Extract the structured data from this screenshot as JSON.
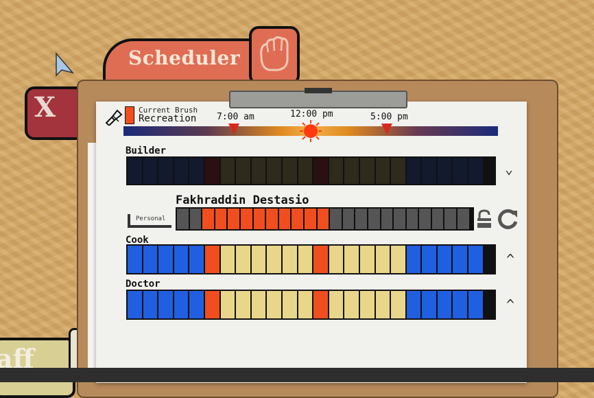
{
  "header": {
    "tab_title": "Scheduler",
    "close_label": "X",
    "staff_tab_label": "aff"
  },
  "brush": {
    "caption": "Current Brush",
    "name": "Recreation",
    "color": "#f04e1e"
  },
  "timeline": {
    "labels": [
      "7:00 am",
      "12:00 pm",
      "5:00 pm"
    ]
  },
  "colors": {
    "dark": "#131a2e",
    "brown": "#2e2a1c",
    "maroon": "#2a1010",
    "blue": "#1f5fe0",
    "yellow": "#e8d78a",
    "orange": "#f04e1e",
    "gray": "#555555"
  },
  "rows": [
    {
      "label": "Builder",
      "chevron": "⌄",
      "pattern": [
        "dark",
        "dark",
        "dark",
        "dark",
        "dark",
        "maroon",
        "brown",
        "brown",
        "brown",
        "brown",
        "brown",
        "brown",
        "maroon",
        "brown",
        "brown",
        "brown",
        "brown",
        "brown",
        "dark",
        "dark",
        "dark",
        "dark",
        "dark"
      ]
    },
    {
      "label": "Cook",
      "chevron": "^",
      "pattern": [
        "blue",
        "blue",
        "blue",
        "blue",
        "blue",
        "orange",
        "yellow",
        "yellow",
        "yellow",
        "yellow",
        "yellow",
        "yellow",
        "orange",
        "yellow",
        "yellow",
        "yellow",
        "yellow",
        "yellow",
        "blue",
        "blue",
        "blue",
        "blue",
        "blue"
      ]
    },
    {
      "label": "Doctor",
      "chevron": "^",
      "pattern": [
        "blue",
        "blue",
        "blue",
        "blue",
        "blue",
        "orange",
        "yellow",
        "yellow",
        "yellow",
        "yellow",
        "yellow",
        "yellow",
        "orange",
        "yellow",
        "yellow",
        "yellow",
        "yellow",
        "yellow",
        "blue",
        "blue",
        "blue",
        "blue",
        "blue"
      ]
    }
  ],
  "person": {
    "name": "Fakhraddin Destasio",
    "personal_label": "Personal",
    "pattern": [
      "gray",
      "gray",
      "orange",
      "orange",
      "orange",
      "orange",
      "orange",
      "orange",
      "orange",
      "orange",
      "orange",
      "orange",
      "gray",
      "gray",
      "gray",
      "gray",
      "gray",
      "gray",
      "gray",
      "gray",
      "gray",
      "gray",
      "gray"
    ]
  }
}
